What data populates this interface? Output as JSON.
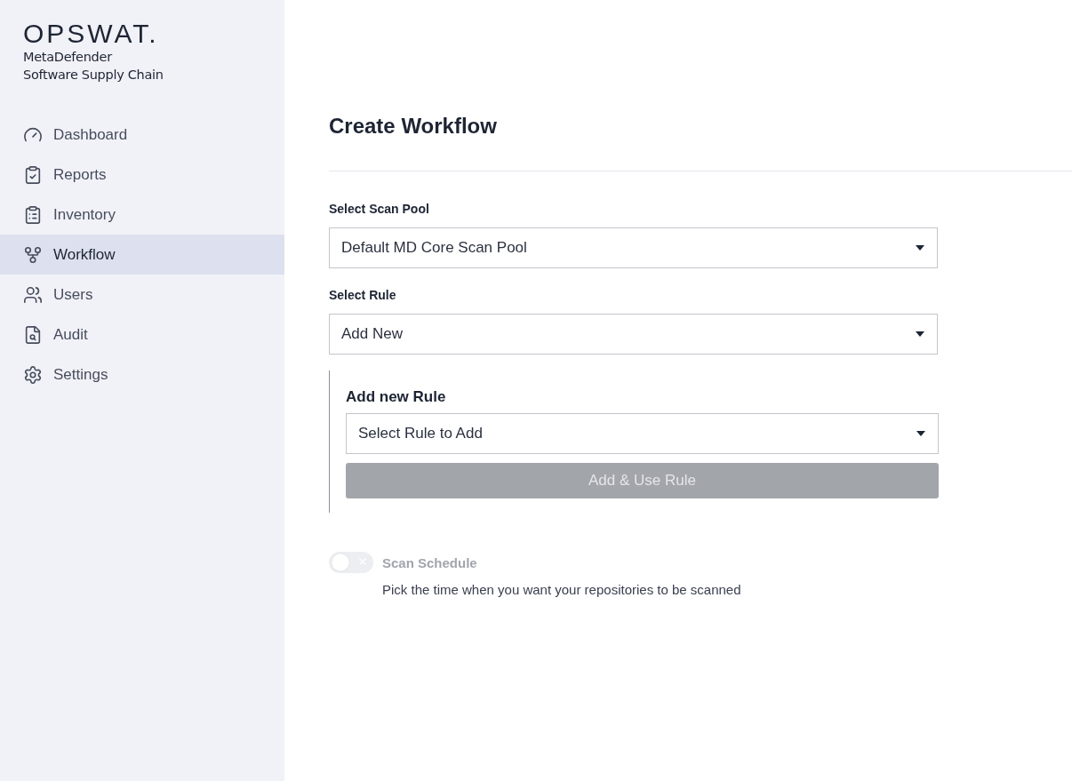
{
  "sidebar": {
    "logo": "OPSWAT.",
    "product_lines": [
      "MetaDefender",
      "Software Supply Chain"
    ],
    "items": [
      {
        "label": "Dashboard",
        "selected": false
      },
      {
        "label": "Reports",
        "selected": false
      },
      {
        "label": "Inventory",
        "selected": false
      },
      {
        "label": "Workflow",
        "selected": true
      },
      {
        "label": "Users",
        "selected": false
      },
      {
        "label": "Audit",
        "selected": false
      },
      {
        "label": "Settings",
        "selected": false
      }
    ]
  },
  "page": {
    "title": "Create Workflow",
    "scan_pool": {
      "label": "Select Scan Pool",
      "value": "Default MD Core Scan Pool"
    },
    "rule": {
      "label": "Select Rule",
      "value": "Add New"
    },
    "new_rule": {
      "title": "Add new Rule",
      "placeholder": "Select Rule to Add",
      "button": {
        "label": "Add & Use Rule",
        "disabled": true
      }
    },
    "schedule": {
      "label": "Scan Schedule",
      "on": false,
      "disabled": true,
      "description": "Pick the time when you want your repositories to be scanned"
    }
  }
}
